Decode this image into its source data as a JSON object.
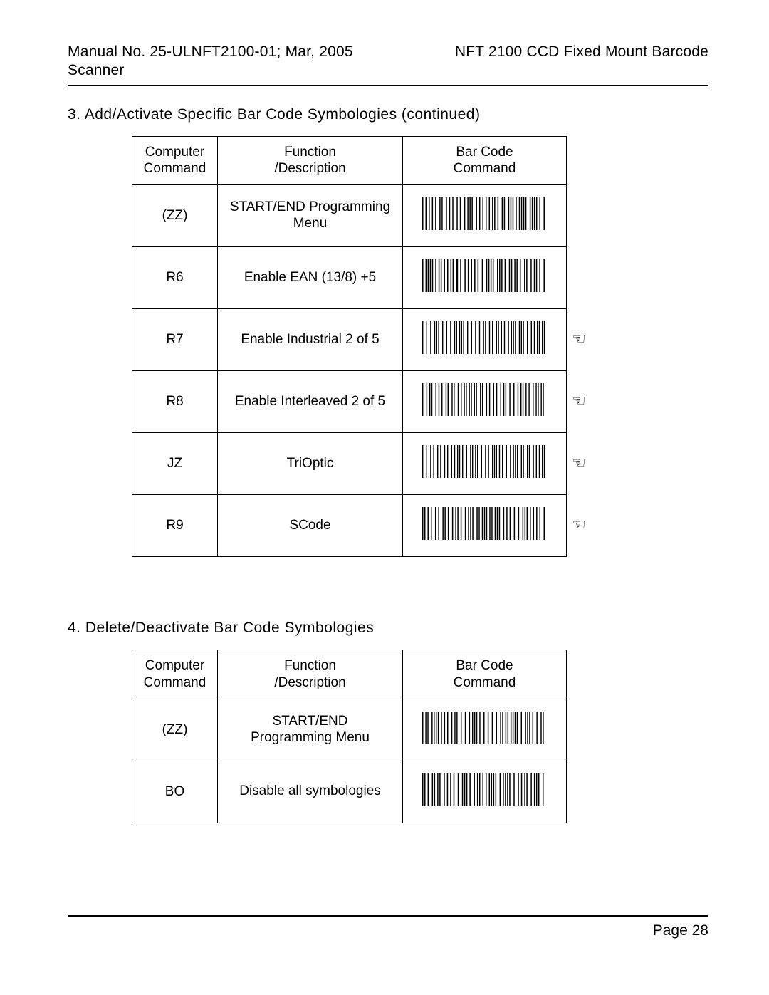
{
  "header": {
    "left": "Manual No. 25-ULNFT2100-01; Mar, 2005",
    "right_line": "NFT 2100 CCD Fixed Mount Barcode",
    "right_wrap": "Scanner"
  },
  "section3": {
    "title": "3. Add/Activate Specific Bar Code Symbologies (continued)",
    "columns": {
      "c1a": "Computer",
      "c1b": "Command",
      "c2a": "Function",
      "c2b": "/Description",
      "c3a": "Bar Code",
      "c3b": "Command"
    },
    "rows": [
      {
        "cmd": "(ZZ)",
        "desc": "START/END Programming Menu",
        "hand": false
      },
      {
        "cmd": "R6",
        "desc": "Enable EAN (13/8) +5",
        "hand": false
      },
      {
        "cmd": "R7",
        "desc": "Enable Industrial 2 of 5",
        "hand": true
      },
      {
        "cmd": "R8",
        "desc": "Enable Interleaved 2 of 5",
        "hand": true
      },
      {
        "cmd": "JZ",
        "desc": "TriOptic",
        "hand": true
      },
      {
        "cmd": "R9",
        "desc": "SCode",
        "hand": true
      }
    ]
  },
  "section4": {
    "title": "4. Delete/Deactivate Bar Code Symbologies",
    "columns": {
      "c1a": "Computer",
      "c1b": "Command",
      "c2a": "Function",
      "c2b": "/Description",
      "c3a": "Bar Code",
      "c3b": "Command"
    },
    "rows": [
      {
        "cmd": "(ZZ)",
        "desc": "START/END\nProgramming Menu"
      },
      {
        "cmd": "BO",
        "desc": "Disable all symbologies"
      }
    ]
  },
  "footer": {
    "page": "Page 28"
  },
  "icons": {
    "hand_glyph": "☜"
  }
}
